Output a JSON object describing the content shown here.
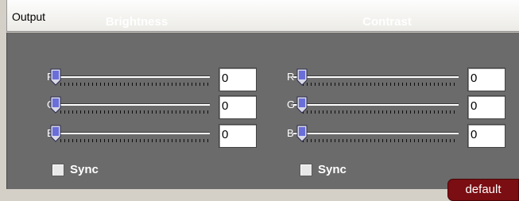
{
  "header": {
    "title": "Output"
  },
  "brightness": {
    "title": "Brightness",
    "channels": [
      {
        "label": "R",
        "value": "0"
      },
      {
        "label": "G",
        "value": "0"
      },
      {
        "label": "B",
        "value": "0"
      }
    ],
    "sync_label": "Sync",
    "sync_checked": false
  },
  "contrast": {
    "title": "Contrast",
    "channels": [
      {
        "label": "R",
        "value": "0"
      },
      {
        "label": "G",
        "value": "0"
      },
      {
        "label": "B",
        "value": "0"
      }
    ],
    "sync_label": "Sync",
    "sync_checked": false
  },
  "default_button": {
    "label": "default"
  },
  "colors": {
    "panel": "#6b6b6b",
    "button": "#7a0e12",
    "thumb": "#6a6ed8"
  },
  "icons": {
    "slider_thumb": "slider-thumb-icon"
  }
}
